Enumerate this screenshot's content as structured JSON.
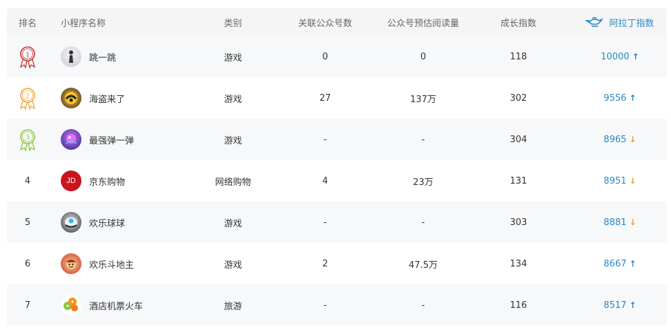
{
  "header": {
    "rank": "排名",
    "name": "小程序名称",
    "category": "类别",
    "accounts": "关联公众号数",
    "reads": "公众号预估阅读量",
    "growth": "成长指数",
    "index": "阿拉丁指数"
  },
  "rows": [
    {
      "rank": "1",
      "name": "跳一跳",
      "category": "游戏",
      "accounts": "0",
      "reads": "0",
      "growth": "118",
      "index": "10000",
      "trend": "↑"
    },
    {
      "rank": "2",
      "name": "海盗来了",
      "category": "游戏",
      "accounts": "27",
      "reads": "137万",
      "growth": "302",
      "index": "9556",
      "trend": "↑"
    },
    {
      "rank": "3",
      "name": "最强弹一弹",
      "category": "游戏",
      "accounts": "-",
      "reads": "-",
      "growth": "304",
      "index": "8965",
      "trend": "↓"
    },
    {
      "rank": "4",
      "name": "京东购物",
      "category": "网络购物",
      "accounts": "4",
      "reads": "23万",
      "growth": "131",
      "index": "8951",
      "trend": "↓",
      "avatar_text": "JD"
    },
    {
      "rank": "5",
      "name": "欢乐球球",
      "category": "游戏",
      "accounts": "-",
      "reads": "-",
      "growth": "303",
      "index": "8881",
      "trend": "↓"
    },
    {
      "rank": "6",
      "name": "欢乐斗地主",
      "category": "游戏",
      "accounts": "2",
      "reads": "47.5万",
      "growth": "134",
      "index": "8667",
      "trend": "↑"
    },
    {
      "rank": "7",
      "name": "酒店机票火车",
      "category": "旅游",
      "accounts": "-",
      "reads": "-",
      "growth": "116",
      "index": "8517",
      "trend": "↑"
    }
  ],
  "colors": {
    "accent": "#2a87c4",
    "down_arrow": "#e6a532",
    "medal_gold": "#c9302c",
    "medal_silver": "#f0a23a",
    "medal_bronze": "#8cc63f"
  }
}
